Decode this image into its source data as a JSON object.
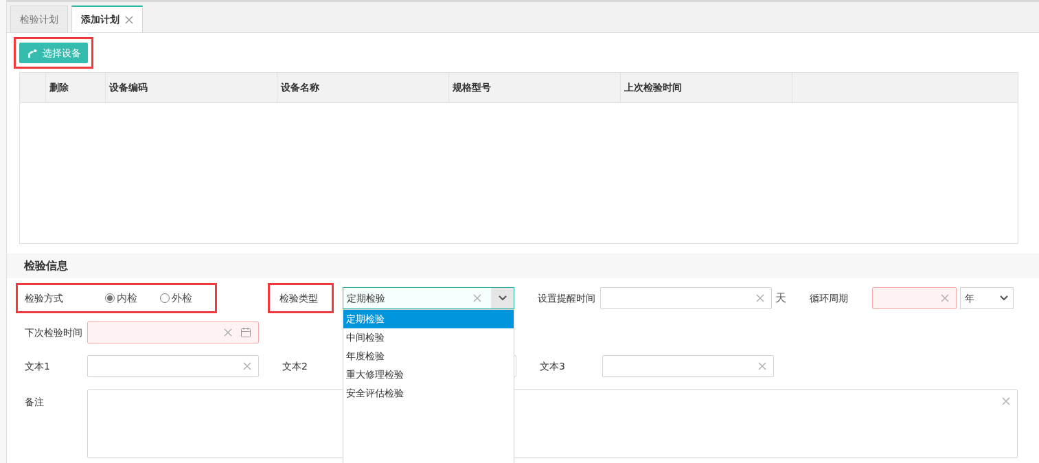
{
  "tabs": [
    {
      "label": "检验计划",
      "selected": false,
      "closable": false
    },
    {
      "label": "添加计划",
      "selected": true,
      "closable": true
    }
  ],
  "select_button": {
    "label": "选择设备",
    "highlighted": true
  },
  "table": {
    "columns": [
      "删除",
      "设备编码",
      "设备名称",
      "规格型号",
      "上次检验时间"
    ]
  },
  "section_title": "检验信息",
  "inspection_method": {
    "label": "检验方式",
    "highlighted": true,
    "options": [
      {
        "label": "内检",
        "selected": true
      },
      {
        "label": "外检",
        "selected": false
      }
    ]
  },
  "inspection_type": {
    "label": "检验类型",
    "highlighted": true,
    "value": "定期检验",
    "expanded": true,
    "options": [
      {
        "label": "定期检验",
        "selected": true
      },
      {
        "label": "中间检验",
        "selected": false
      },
      {
        "label": "年度检验",
        "selected": false
      },
      {
        "label": "重大修理检验",
        "selected": false
      },
      {
        "label": "安全评估检验",
        "selected": false
      }
    ]
  },
  "reminder": {
    "label": "设置提醒时间",
    "unit": "天",
    "required": false
  },
  "cycle": {
    "label": "循环周期",
    "required": true,
    "unit": "年"
  },
  "next_date": {
    "label": "下次检验时间",
    "required": true
  },
  "text_fields": [
    {
      "label": "文本1"
    },
    {
      "label": "文本2"
    },
    {
      "label": "文本3"
    }
  ],
  "remark": {
    "label": "备注"
  }
}
